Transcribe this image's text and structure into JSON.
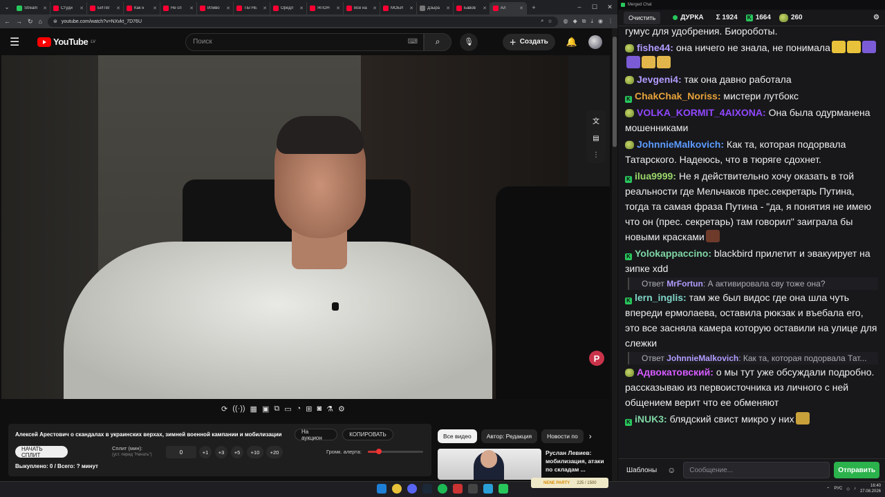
{
  "browser": {
    "tabs": [
      {
        "label": "Stream",
        "color": "#28c75c"
      },
      {
        "label": "Студи",
        "color": "#ff0033"
      },
      {
        "label": "БИТВ/",
        "color": "#ff0033"
      },
      {
        "label": "Как н",
        "color": "#ff0033"
      },
      {
        "label": "Не сп",
        "color": "#ff0033"
      },
      {
        "label": "Иливо",
        "color": "#ff0033"
      },
      {
        "label": "ТЫ НЕ",
        "color": "#ff0033"
      },
      {
        "label": "Оредл",
        "color": "#ff0033"
      },
      {
        "label": "ЯПОН",
        "color": "#ff0033"
      },
      {
        "label": "Все на",
        "color": "#ff0033"
      },
      {
        "label": "МОБИ",
        "color": "#ff0033"
      },
      {
        "label": "Дзыра",
        "color": "#777777"
      },
      {
        "label": "Бавов",
        "color": "#ff0033"
      },
      {
        "label": "Ал",
        "color": "#ff0033",
        "active": true
      }
    ],
    "new_tab": "+",
    "url": "youtube.com/watch?v=NXvkt_7D76U"
  },
  "youtube": {
    "logo_text": "YouTube",
    "region": "LV",
    "search_placeholder": "Поиск",
    "create_label": "Создать"
  },
  "video": {
    "title": "Алексей Арестович о скандалах в украинских верхах, зимней военной кампании и мобилизации"
  },
  "extension": {
    "auction_button": "На аукцион",
    "copy_button": "КОПИРОВАТЬ",
    "start_split_button": "НАЧАТЬ СПЛИТ",
    "split_label": "Сплит (мин):",
    "split_hint": "(уст. перед \"Начать\")",
    "split_value": "0",
    "increments": [
      "+1",
      "+3",
      "+5",
      "+10",
      "+20"
    ],
    "volume_label": "Громк. алерта:",
    "volume_level": 0.2,
    "bought_text": "Выкуплено: 0 / Всего: ? минут"
  },
  "recommendations": {
    "chips": [
      "Все видео",
      "Автор: Редакция",
      "Новости по"
    ],
    "first_title": "Руслан Левиев: мобилизация, атаки по складам ..."
  },
  "chat": {
    "window_title": "Merged Chat",
    "clear_button": "Очистить",
    "status_name": "ДУРКА",
    "total_label": "Σ 1924",
    "kick_count": "1664",
    "twitch_count": "260",
    "partial_top": "гумус для удобрения. Биороботы.",
    "messages": [
      {
        "badge": "frog",
        "user": "fishe44",
        "color": "#b39cff",
        "text": "она ничего не знала, не понимала",
        "emotes": [
          "#e8c23a",
          "#e8c23a",
          "#7b5cd6",
          "#7b5cd6",
          "#e2b64a",
          "#e2b64a"
        ]
      },
      {
        "badge": "frog",
        "user": "Jevgeni4",
        "color": "#b39cff",
        "text": "так она давно работала",
        "emotes": []
      },
      {
        "badge": "kick",
        "user": "ChakChak_Noriss",
        "color": "#e8a33a",
        "text": "мистери лутбокс",
        "emotes": []
      },
      {
        "badge": "frog",
        "user": "VOLKA_KORMIT_4AIXONA",
        "color": "#9147ff",
        "text": "Она была одурманена мошенниками",
        "emotes": []
      },
      {
        "badge": "frog",
        "user": "JohnnieMalkovich",
        "color": "#5c9bff",
        "text": "Как та, которая подорвала Татарского. Надеюсь, что в тюряге сдохнет.",
        "emotes": []
      },
      {
        "badge": "kick",
        "user": "ilua9999",
        "color": "#9ad66a",
        "text": "Не я действительно хочу оказать в той реальности где Мельчаков прес.секретарь Путина, тогда та самая фраза Путина - \"да, я понятия не имею что он (прес. секретарь) там говорил\" заиграла бы новыми красками",
        "emotes": [
          "#6e3a2a"
        ]
      },
      {
        "badge": "kick",
        "user": "Yolokappaccino",
        "color": "#7fd6a4",
        "text": "blackbird прилетит и эвакуирует на зипке xdd",
        "emotes": []
      },
      {
        "reply_to": "MrFortun",
        "reply_text": "А активировала сву тоже она?",
        "badge": "kick",
        "user": "lern_inglis",
        "color": "#7fd6c8",
        "text": "там же был видос где она шла чуть впереди ермолаева, оставила рюкзак и въебала его, это все засняла камера которую оставили на улице для слежки",
        "emotes": []
      },
      {
        "reply_to": "JohnnieMalkovich",
        "reply_text": "Как та, которая подорвала Тат...",
        "badge": "frog",
        "user": "Адвокатовский",
        "color": "#d65cff",
        "text": "о мы тут уже обсуждали подробно. рассказываю из первоисточника из личного с ней общением верит что ее обменяют",
        "emotes": []
      },
      {
        "badge": "kick",
        "user": "iNUK3",
        "color": "#7fd6a4",
        "text": "блядский свист микро у них",
        "emotes": [
          "#c9a13a"
        ]
      }
    ],
    "templates_button": "Шаблоны",
    "input_placeholder": "Сообщение...",
    "send_button": "Отправить"
  },
  "taskbar": {
    "nene_label": "NENE PARTY",
    "nene_progress": "225 / 1500",
    "lang": "РУС",
    "time": "16:40",
    "date": "27.08.2026"
  }
}
